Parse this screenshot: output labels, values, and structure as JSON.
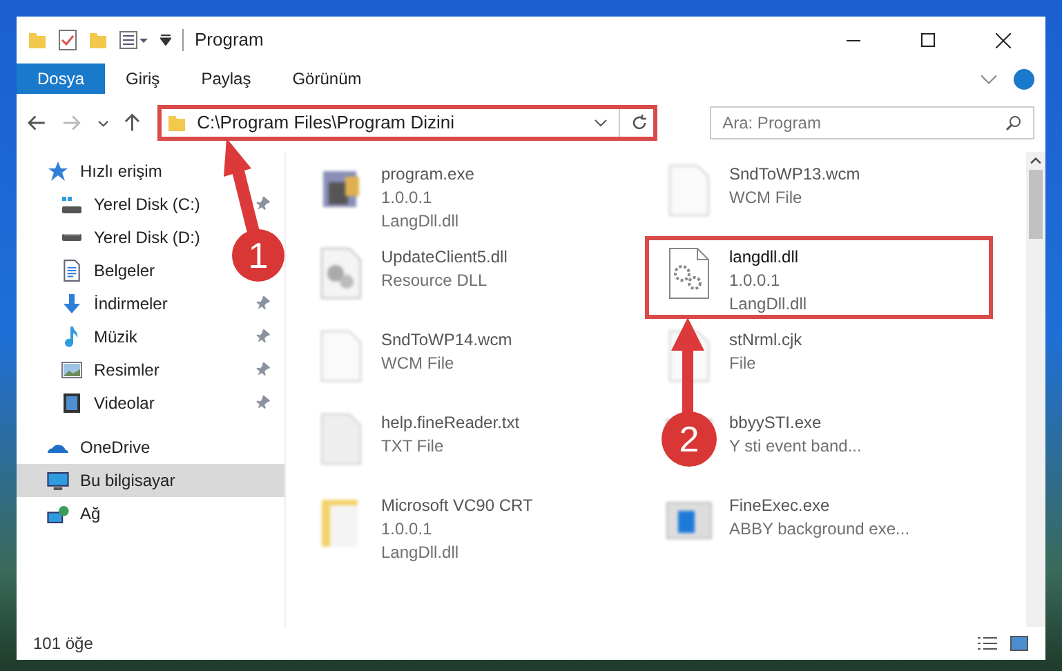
{
  "window": {
    "title": "Program"
  },
  "ribbon_tabs": [
    {
      "label": "Dosya",
      "selected": true
    },
    {
      "label": "Giriş",
      "selected": false
    },
    {
      "label": "Paylaş",
      "selected": false
    },
    {
      "label": "Görünüm",
      "selected": false
    }
  ],
  "address": {
    "path": "C:\\Program Files\\Program Dizini",
    "highlighted": true
  },
  "search": {
    "placeholder": "Ara: Program"
  },
  "sidebar": {
    "items": [
      {
        "label": "Hızlı erişim",
        "kind": "star",
        "selected": false,
        "children": [
          {
            "label": "Yerel Disk (C:)",
            "kind": "drive-c",
            "pinned": true,
            "selected": false
          },
          {
            "label": "Yerel Disk (D:)",
            "kind": "drive",
            "pinned": false,
            "selected": false
          },
          {
            "label": "Belgeler",
            "kind": "document",
            "pinned": false,
            "selected": false
          },
          {
            "label": "İndirmeler",
            "kind": "download",
            "pinned": true,
            "selected": false
          },
          {
            "label": "Müzik",
            "kind": "music",
            "pinned": true,
            "selected": false
          },
          {
            "label": "Resimler",
            "kind": "pictures",
            "pinned": true,
            "selected": false
          },
          {
            "label": "Videolar",
            "kind": "video",
            "pinned": true,
            "selected": false
          }
        ]
      },
      {
        "label": "OneDrive",
        "kind": "cloud",
        "selected": false
      },
      {
        "label": "Bu bilgisayar",
        "kind": "computer",
        "selected": true
      },
      {
        "label": "Ağ",
        "kind": "network",
        "selected": false
      }
    ]
  },
  "files": [
    {
      "name": "program.exe",
      "details": [
        "1.0.0.1",
        "LangDll.dll"
      ],
      "kind": "app",
      "blurred": true,
      "highlighted": false
    },
    {
      "name": "SndToWP13.wcm",
      "details": [
        "WCM File"
      ],
      "kind": "blank",
      "blurred": true,
      "highlighted": false
    },
    {
      "name": "UpdateClient5.dll",
      "details": [
        "Resource DLL"
      ],
      "kind": "dll",
      "blurred": true,
      "highlighted": false
    },
    {
      "name": "langdll.dll",
      "details": [
        "1.0.0.1",
        "LangDll.dll"
      ],
      "kind": "gear",
      "blurred": false,
      "highlighted": true
    },
    {
      "name": "SndToWP14.wcm",
      "details": [
        "WCM File"
      ],
      "kind": "blank",
      "blurred": true,
      "highlighted": false
    },
    {
      "name": "stNrml.cjk",
      "details": [
        "File"
      ],
      "kind": "blank",
      "blurred": true,
      "highlighted": false
    },
    {
      "name": "help.fineReader.txt",
      "details": [
        "TXT File"
      ],
      "kind": "text",
      "blurred": true,
      "highlighted": false
    },
    {
      "name": "bbyySTI.exe",
      "details": [
        "Y sti event band..."
      ],
      "kind": "window",
      "blurred": true,
      "highlighted": false
    },
    {
      "name": "Microsoft VC90 CRT",
      "details": [
        "1.0.0.1",
        "LangDll.dll"
      ],
      "kind": "folder",
      "blurred": true,
      "highlighted": false
    },
    {
      "name": "FineExec.exe",
      "details": [
        "ABBY background exe..."
      ],
      "kind": "window",
      "blurred": true,
      "highlighted": false
    }
  ],
  "status_bar": {
    "count": "101 öğe"
  },
  "markers": [
    {
      "label": "1"
    },
    {
      "label": "2"
    }
  ]
}
